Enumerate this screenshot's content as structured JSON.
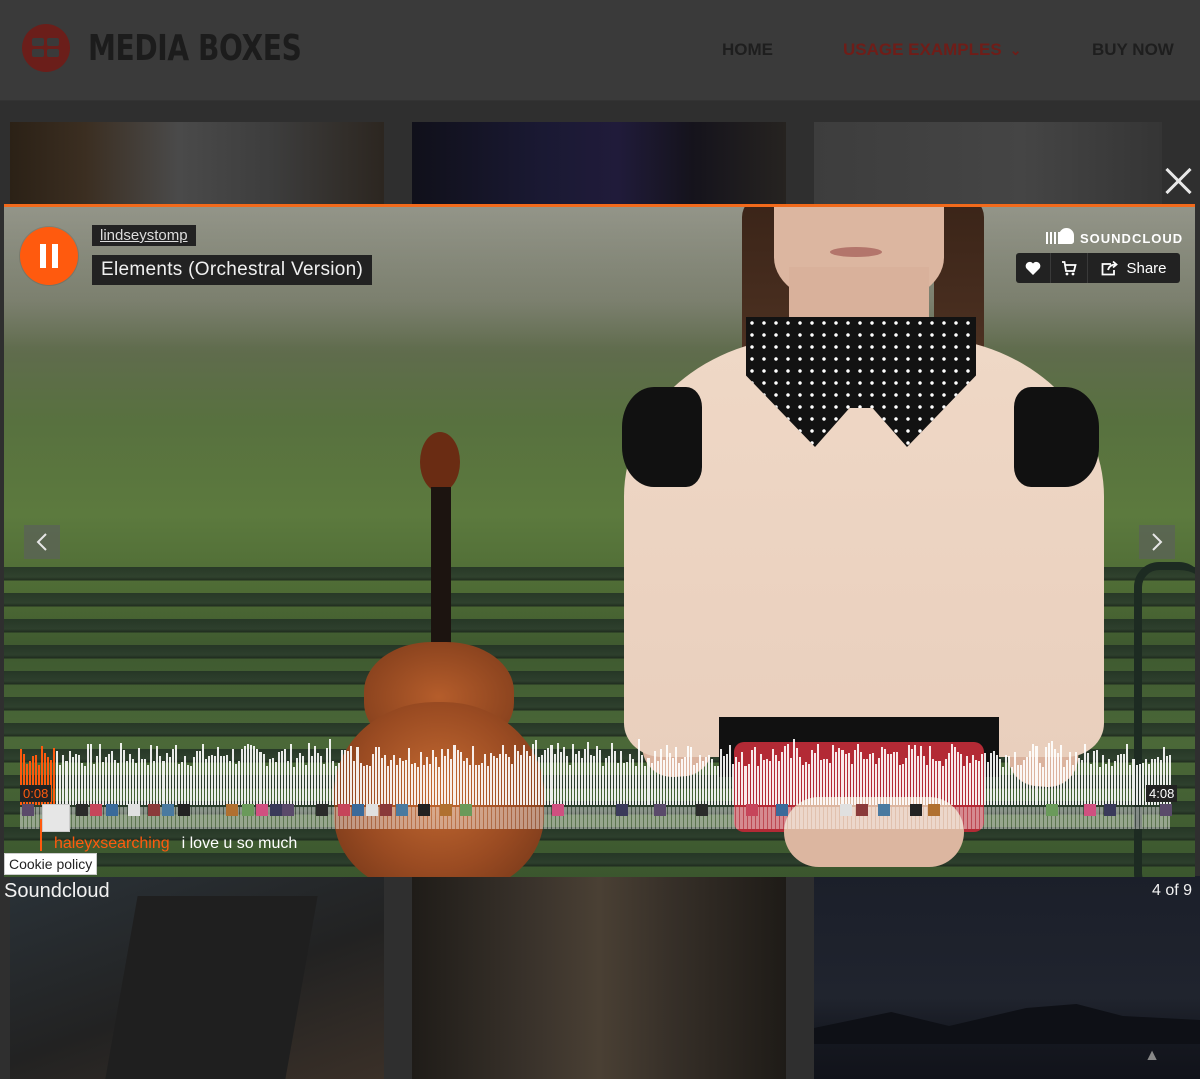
{
  "header": {
    "brand": "MEDIA BOXES",
    "nav": [
      {
        "label": "HOME"
      },
      {
        "label": "USAGE EXAMPLES"
      },
      {
        "label": "BUY NOW"
      }
    ]
  },
  "player": {
    "artist": "lindseystomp",
    "title": "Elements (Orchestral Version)",
    "brand": "SOUNDCLOUD",
    "share_label": "Share",
    "current_time": "0:08",
    "duration": "4:08",
    "progress": 0.032,
    "comment": {
      "user": "haleyxsearching",
      "text": "i love u so much"
    },
    "accent_color": "#ff5a0e"
  },
  "lightbox": {
    "caption": "Soundcloud",
    "counter": "4 of 9"
  },
  "cookie_label": "Cookie policy",
  "icons": [
    "menu-grid-icon",
    "chevron-down-icon",
    "close-icon",
    "pause-icon",
    "soundcloud-icon",
    "heart-icon",
    "cart-icon",
    "share-icon",
    "arrow-left-icon",
    "arrow-right-icon",
    "scroll-top-icon"
  ]
}
